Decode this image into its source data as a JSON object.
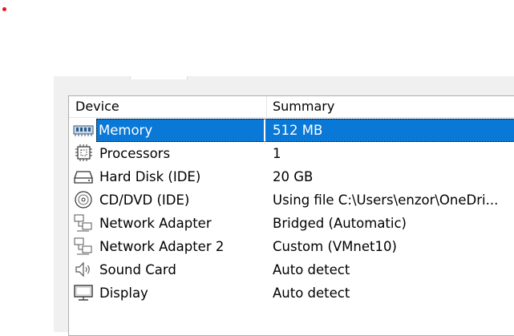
{
  "columns": {
    "device": "Device",
    "summary": "Summary"
  },
  "devices": [
    {
      "name": "Memory",
      "summary": "512 MB",
      "icon": "memory-icon",
      "selected": true
    },
    {
      "name": "Processors",
      "summary": "1",
      "icon": "processor-icon"
    },
    {
      "name": "Hard Disk (IDE)",
      "summary": "20 GB",
      "icon": "hard-disk-icon"
    },
    {
      "name": "CD/DVD (IDE)",
      "summary": "Using file C:\\Users\\enzor\\OneDri...",
      "icon": "cd-dvd-icon"
    },
    {
      "name": "Network Adapter",
      "summary": "Bridged (Automatic)",
      "icon": "network-adapter-icon"
    },
    {
      "name": "Network Adapter 2",
      "summary": "Custom (VMnet10)",
      "icon": "network-adapter-icon"
    },
    {
      "name": "Sound Card",
      "summary": "Auto detect",
      "icon": "sound-card-icon"
    },
    {
      "name": "Display",
      "summary": "Auto detect",
      "icon": "display-icon"
    }
  ],
  "colors": {
    "selection": "#0a78d7",
    "panel_background": "#f0f0f0",
    "list_border": "#adadad"
  }
}
